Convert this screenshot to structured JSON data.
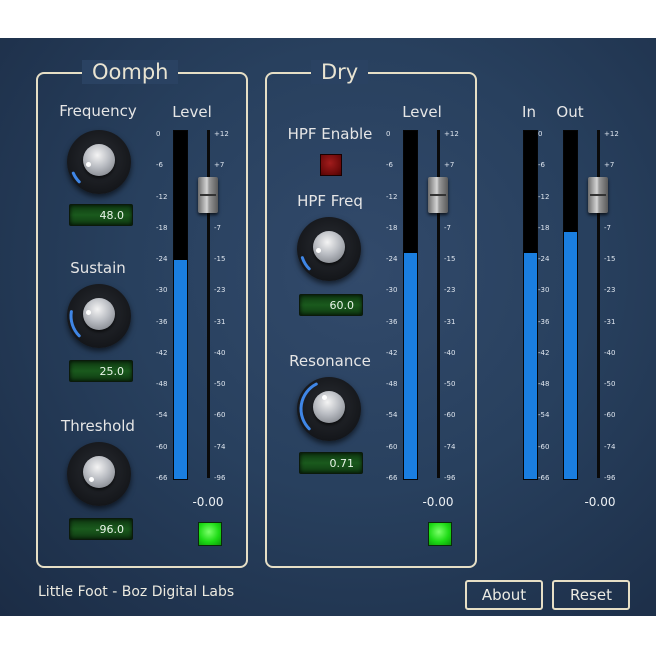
{
  "footer": {
    "brand": "Little Foot - Boz Digital Labs",
    "about_label": "About",
    "reset_label": "Reset"
  },
  "oomph": {
    "title": "Oomph",
    "level_label": "Level",
    "frequency": {
      "label": "Frequency",
      "value": "48.0",
      "fraction": 0.08
    },
    "sustain": {
      "label": "Sustain",
      "value": "25.0",
      "fraction": 0.2
    },
    "threshold": {
      "label": "Threshold",
      "value": "-96.0",
      "fraction": 0.0
    },
    "meter_level_fraction": 0.63,
    "fader_gain": "-0.00",
    "enabled_led": "on"
  },
  "dry": {
    "title": "Dry",
    "level_label": "Level",
    "hpf_enable": {
      "label": "HPF Enable",
      "state": "off"
    },
    "hpf_freq": {
      "label": "HPF Freq",
      "value": "60.0",
      "fraction": 0.1
    },
    "resonance": {
      "label": "Resonance",
      "value": "0.71",
      "fraction": 0.4
    },
    "meter_level_fraction": 0.65,
    "fader_gain": "-0.00",
    "enabled_led": "on"
  },
  "output": {
    "in_label": "In",
    "out_label": "Out",
    "in_level_fraction": 0.65,
    "out_level_fraction": 0.71,
    "fader_gain": "-0.00"
  },
  "meter_scale": [
    "0",
    "-6",
    "-12",
    "-18",
    "-24",
    "-30",
    "-36",
    "-42",
    "-48",
    "-54",
    "-60",
    "-66"
  ],
  "fader_scale": [
    "+12",
    "+7",
    "0",
    "-7",
    "-15",
    "-23",
    "-31",
    "-40",
    "-50",
    "-60",
    "-74",
    "-96"
  ],
  "colors": {
    "meter_fill": "#1a7ee0",
    "led_green": "#1edc16",
    "led_red": "#6b0909",
    "panel_border": "#e6dfc6"
  }
}
